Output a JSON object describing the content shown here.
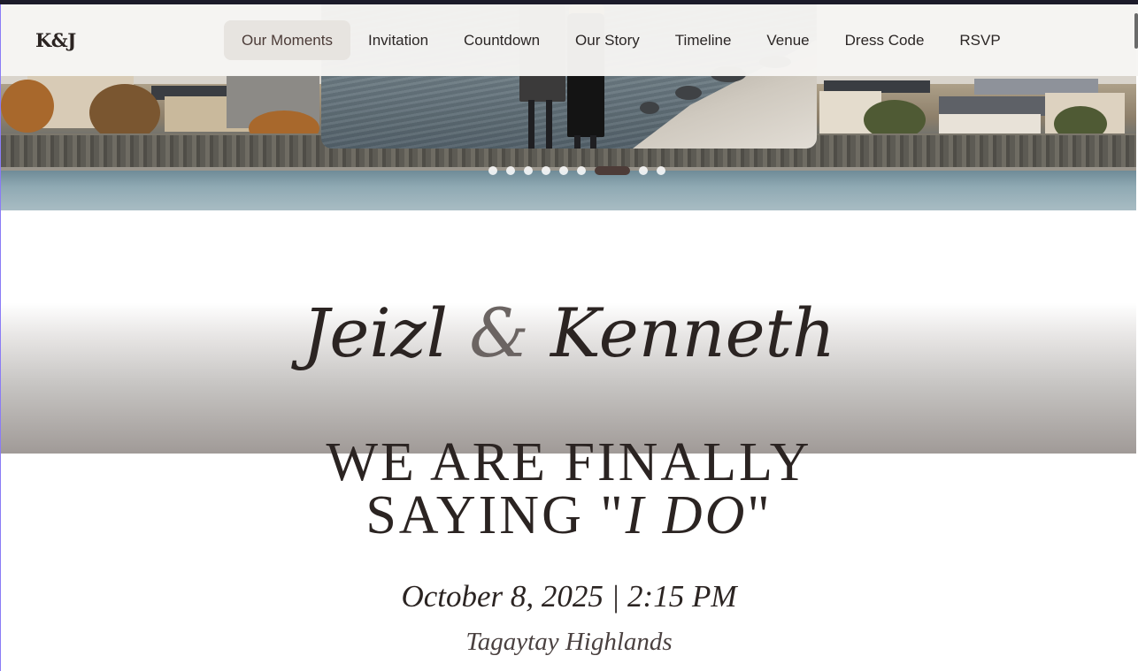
{
  "nav": {
    "logo": "K&J",
    "links": [
      "Our Moments",
      "Invitation",
      "Countdown",
      "Our Story",
      "Timeline",
      "Venue",
      "Dress Code",
      "RSVP"
    ],
    "active_index": 0
  },
  "carousel": {
    "slide_count": 9,
    "active_slide": 7
  },
  "hero": {
    "first_name": "Jeizl",
    "ampersand": "&",
    "second_name": "Kenneth",
    "headline_line1": "WE ARE FINALLY",
    "headline_line2_start": "SAYING \"",
    "headline_line2_em": "I DO",
    "headline_line2_end": "\"",
    "date_time": "October 8, 2025 | 2:15 PM",
    "location": "Tagaytay Highlands"
  },
  "colors": {
    "nav_bg": "#f6f5f3",
    "nav_active_bg": "#e7e4e0",
    "text_dark": "#2b2422",
    "accent_dot": "#4d3c38"
  }
}
